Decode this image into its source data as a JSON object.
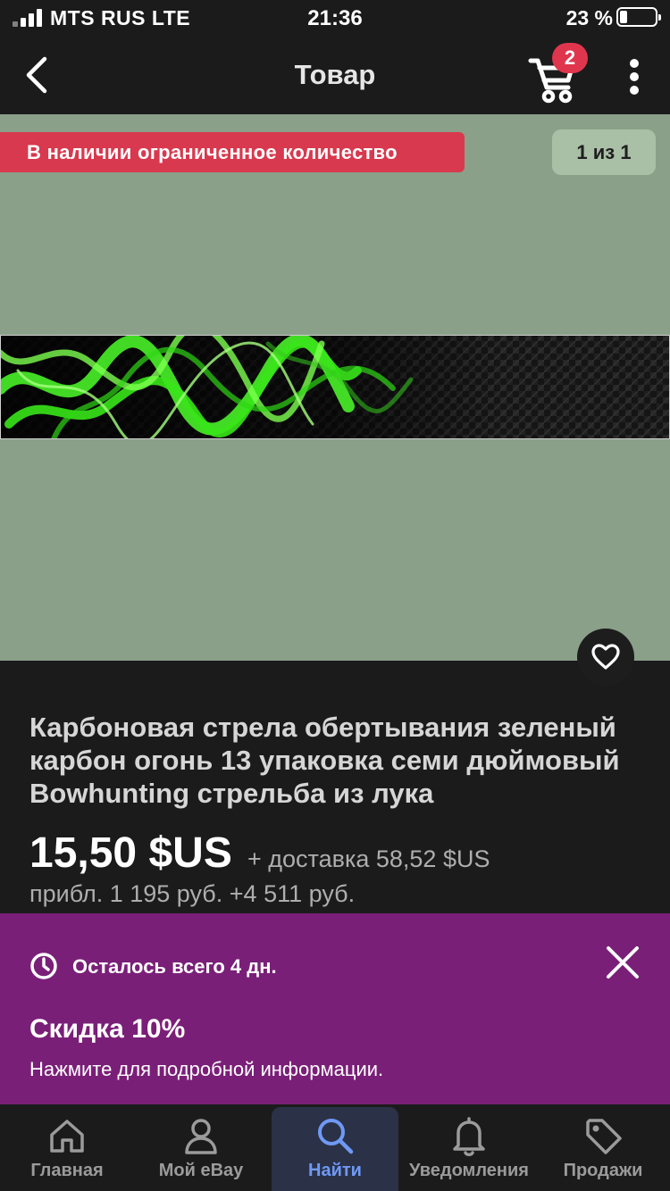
{
  "status_bar": {
    "carrier": "MTS RUS  LTE",
    "time": "21:36",
    "battery": "23 %",
    "battery_level": 0.23
  },
  "nav": {
    "title": "Товар",
    "cart_count": "2"
  },
  "gallery": {
    "stock_label": "В наличии ограниченное количество",
    "counter": "1 из 1"
  },
  "product": {
    "title": "Карбоновая стрела обертывания зеленый карбон огонь 13 упаковка семи дюймовый Bowhunting стрельба из лука",
    "price": "15,50 $US",
    "shipping": "+ доставка 58,52 $US",
    "approx": "прибл. 1 195 руб. +4 511 руб."
  },
  "promo": {
    "timer": "Осталось всего 4 дн.",
    "discount": "Скидка 10%",
    "details": "Нажмите для подробной информации."
  },
  "tabs": [
    {
      "label": "Главная",
      "icon": "home-icon"
    },
    {
      "label": "Мой eBay",
      "icon": "person-icon"
    },
    {
      "label": "Найти",
      "icon": "search-icon",
      "active": true
    },
    {
      "label": "Уведомления",
      "icon": "bell-icon"
    },
    {
      "label": "Продажи",
      "icon": "tag-icon"
    }
  ],
  "colors": {
    "background": "#1b1b1b",
    "stock_banner": "#d8394e",
    "gallery_bg": "#8aa089",
    "promo_bg": "#7a1f78",
    "active_tab": "#6f99f5"
  }
}
